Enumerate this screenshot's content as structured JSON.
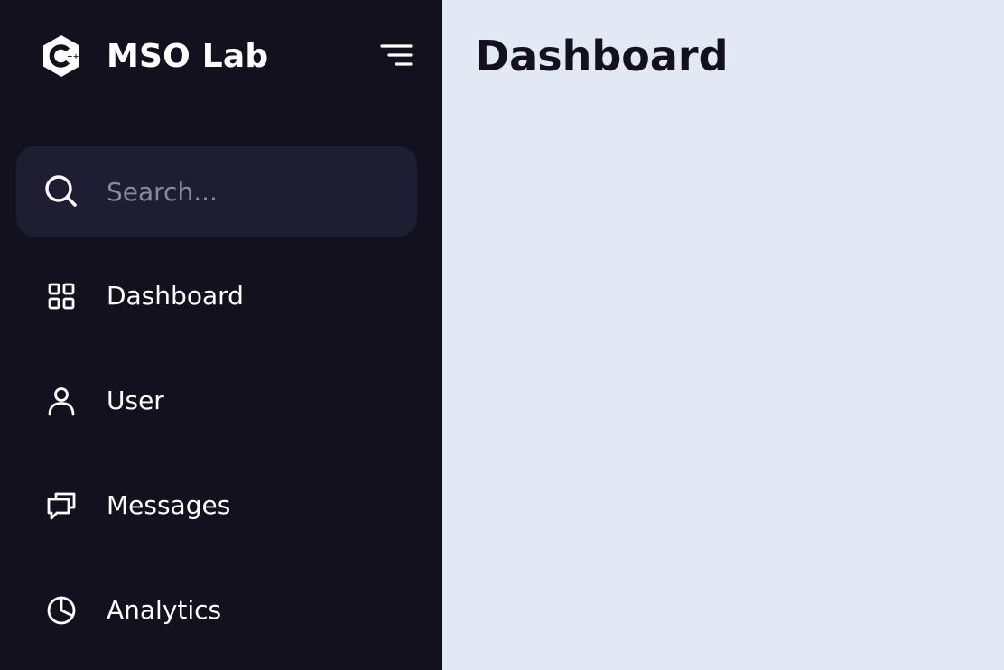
{
  "brand": {
    "name": "MSO Lab",
    "logo_icon": "cplusplus-hexagon-icon"
  },
  "search": {
    "placeholder": "Search...",
    "value": ""
  },
  "nav": {
    "items": [
      {
        "label": "Dashboard",
        "icon": "grid-icon"
      },
      {
        "label": "User",
        "icon": "user-icon"
      },
      {
        "label": "Messages",
        "icon": "chat-bubbles-icon"
      },
      {
        "label": "Analytics",
        "icon": "pie-chart-icon"
      }
    ]
  },
  "main": {
    "title": "Dashboard"
  },
  "colors": {
    "sidebar_bg": "#13111e",
    "search_bg": "#1e1d31",
    "main_bg": "#e3e8f5",
    "text_light": "#ffffff",
    "text_dark": "#13111e",
    "placeholder": "#8b8a94"
  }
}
